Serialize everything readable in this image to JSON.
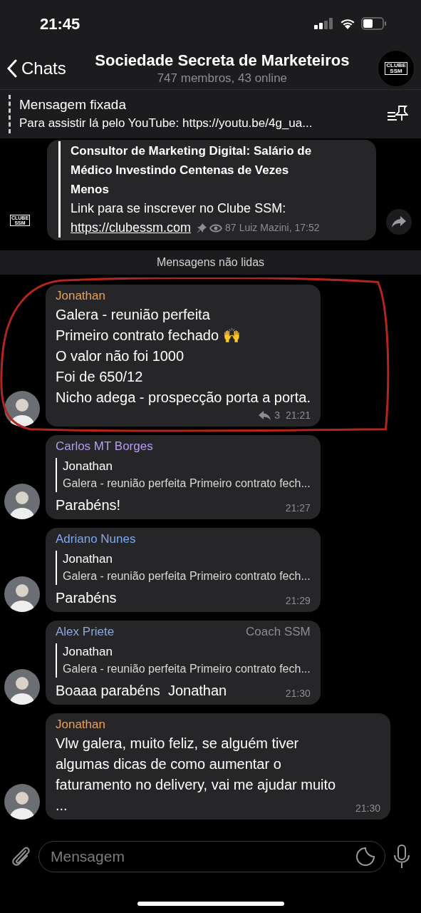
{
  "status_bar": {
    "time": "21:45"
  },
  "header": {
    "back_label": "Chats",
    "title": "Sociedade Secreta de Marketeiros",
    "subtitle": "747 membros, 43 online",
    "logo_lines": [
      "CLUBE",
      "SSM"
    ]
  },
  "pinned": {
    "label": "Mensagem fixada",
    "text": "Para assistir lá pelo YouTube: https://youtu.be/4g_ua..."
  },
  "messages": [
    {
      "kind": "post",
      "logo_lines": [
        "CLUBE",
        "SSM"
      ],
      "bold_lines": [
        "Consultor de Marketing Digital: Salário de",
        "Médico Investindo Centenas de Vezes",
        "Menos"
      ],
      "text": "Link para se inscrever no Clube SSM:",
      "link": "https://clubessm.com",
      "pinned": true,
      "views": "87",
      "signature": "Luiz Mazini, 17:52"
    },
    {
      "kind": "divider",
      "text": "Mensagens não lidas"
    },
    {
      "kind": "message",
      "highlighted": true,
      "author": "Jonathan",
      "color": "#e7a15d",
      "lines": [
        "Galera - reunião perfeita",
        "Primeiro contrato fechado 🙌",
        "O valor não foi 1000",
        "Foi de 650/12",
        "Nicho adega - prospecção porta a porta."
      ],
      "replies": "3",
      "time": "21:21"
    },
    {
      "kind": "message",
      "highlighted": false,
      "author": "Carlos MT Borges",
      "color": "#b59cf0",
      "reply": {
        "author": "Jonathan",
        "text": "Galera - reunião perfeita Primeiro contrato fech..."
      },
      "lines": [
        "Parabéns!"
      ],
      "time": "21:27"
    },
    {
      "kind": "message",
      "highlighted": false,
      "author": "Adriano Nunes",
      "color": "#7fa8ee",
      "reply": {
        "author": "Jonathan",
        "text": "Galera - reunião perfeita Primeiro contrato fech..."
      },
      "lines": [
        "Parabéns"
      ],
      "time": "21:29"
    },
    {
      "kind": "message",
      "highlighted": false,
      "author": "Alex Priete",
      "color": "#8fa6d8",
      "badge": "Coach SSM",
      "reply": {
        "author": "Jonathan",
        "text": "Galera - reunião perfeita Primeiro contrato fech..."
      },
      "lines": [
        "Boaaa parabéns  Jonathan"
      ],
      "time": "21:30"
    },
    {
      "kind": "message",
      "highlighted": false,
      "author": "Jonathan",
      "color": "#e7a15d",
      "lines": [
        "Vlw galera, muito feliz, se alguém tiver algumas dicas de como aumentar o faturamento no delivery, vai me ajudar muito ..."
      ],
      "time": "21:30"
    }
  ],
  "composer": {
    "placeholder": "Mensagem"
  }
}
